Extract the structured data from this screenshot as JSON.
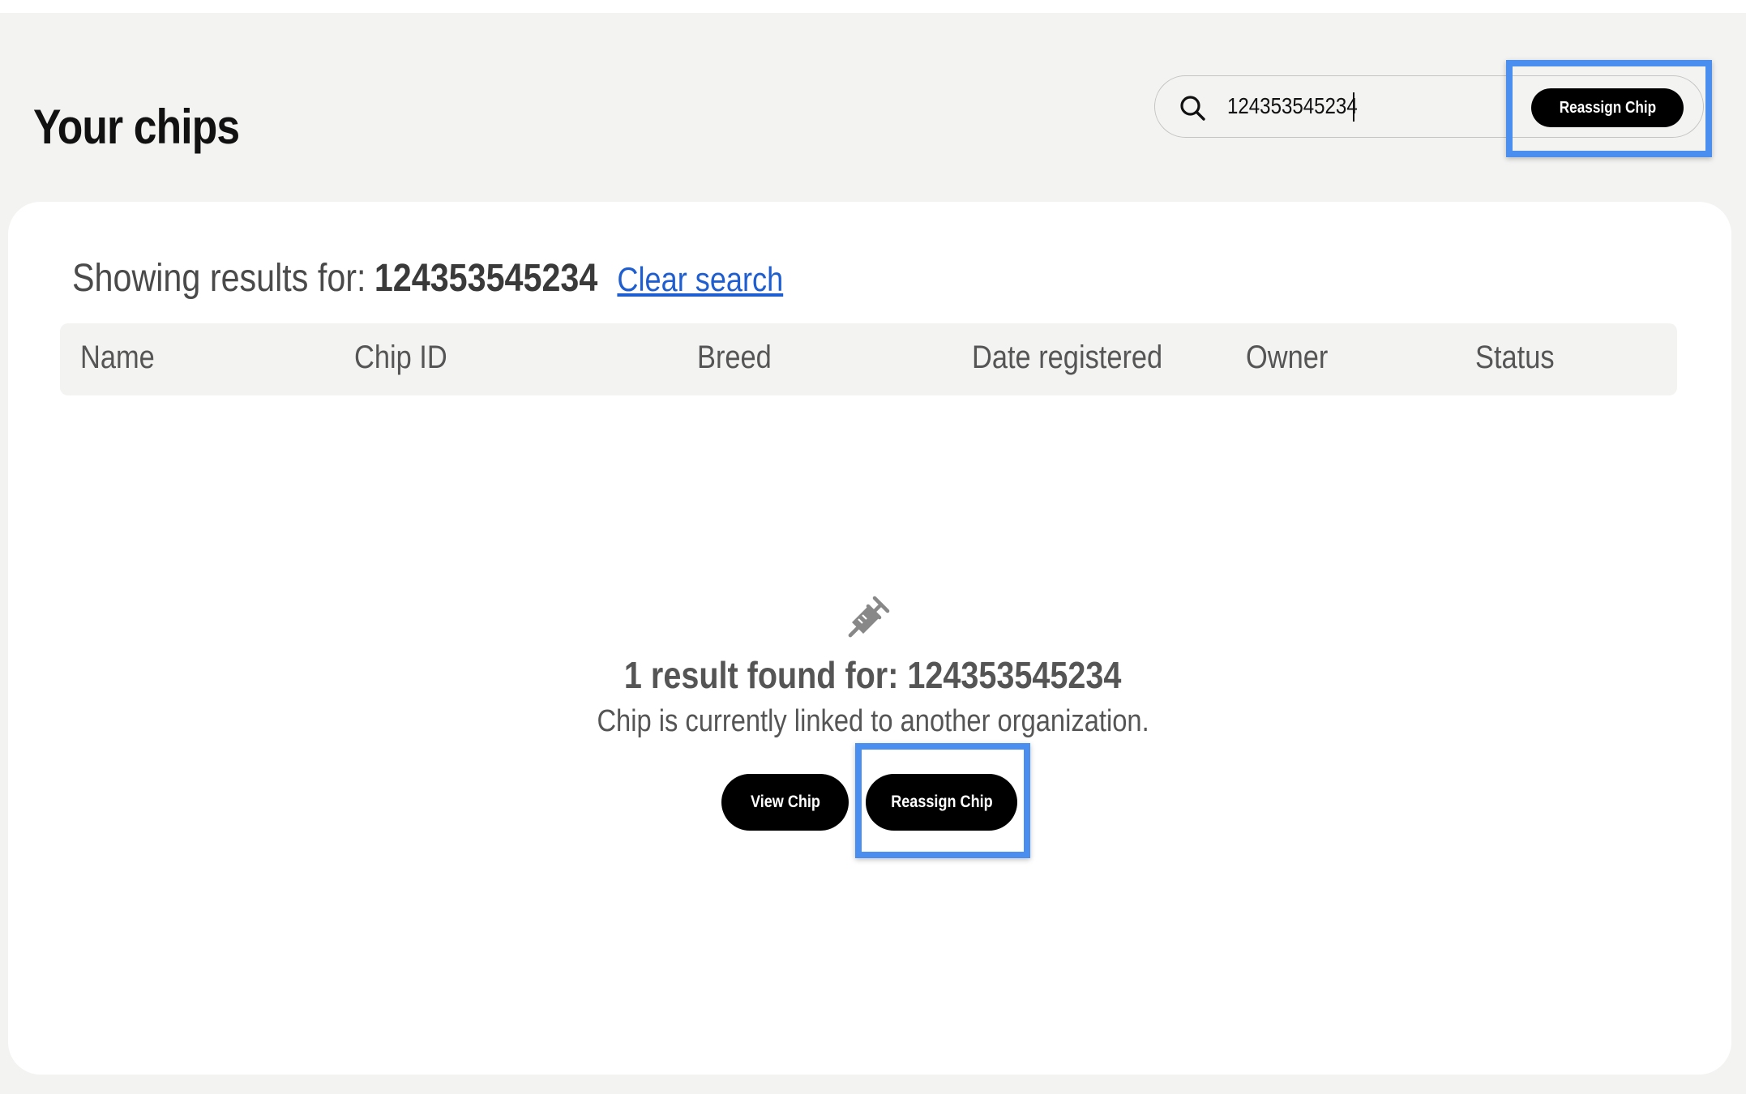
{
  "header": {
    "title": "Your chips"
  },
  "search": {
    "value": "124353545234",
    "icon": "search-icon"
  },
  "toolbar": {
    "reassign_label": "Reassign Chip"
  },
  "results": {
    "label": "Showing results for:",
    "term": "124353545234",
    "clear_label": "Clear search"
  },
  "table": {
    "columns": [
      "Name",
      "Chip ID",
      "Breed",
      "Date registered",
      "Owner",
      "Status"
    ]
  },
  "empty_state": {
    "icon": "syringe-icon",
    "heading": "1 result found for: 124353545234",
    "message": "Chip is currently linked to another organization.",
    "view_label": "View Chip",
    "reassign_label": "Reassign Chip"
  },
  "colors": {
    "highlight": "#4a8ff0",
    "link": "#1f5ed0",
    "button": "#000000",
    "page_background": "#f3f3f2"
  }
}
